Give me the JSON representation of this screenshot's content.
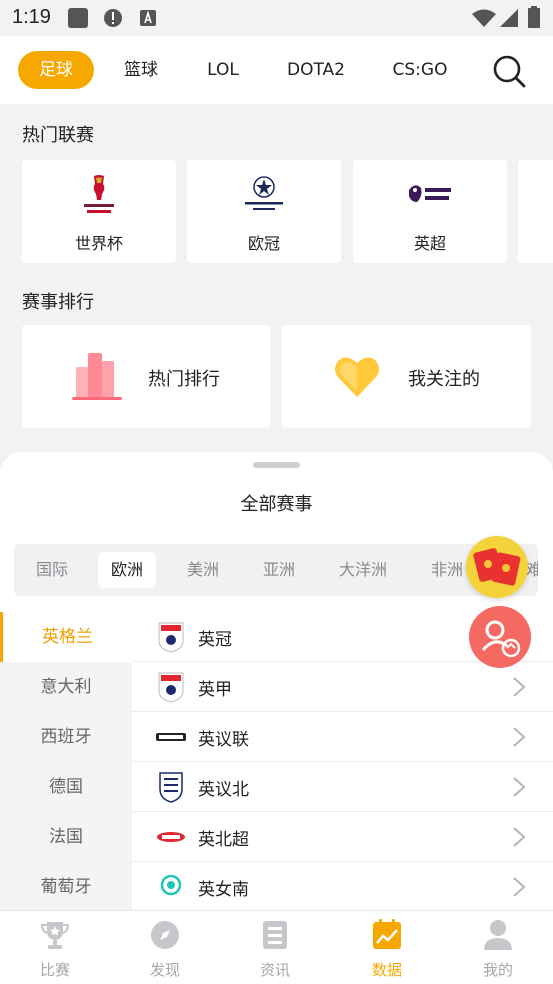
{
  "status_bar": {
    "time": "1:19"
  },
  "top_tabs": [
    {
      "label": "足球",
      "active": true
    },
    {
      "label": "篮球",
      "active": false
    },
    {
      "label": "LOL",
      "active": false
    },
    {
      "label": "DOTA2",
      "active": false
    },
    {
      "label": "CS:GO",
      "active": false
    }
  ],
  "hot_leagues": {
    "title": "热门联赛",
    "items": [
      {
        "name": "世界杯",
        "logo": "fifa-world-cup-logo"
      },
      {
        "name": "欧冠",
        "logo": "champions-league-logo"
      },
      {
        "name": "英超",
        "logo": "premier-league-logo"
      }
    ]
  },
  "rankings": {
    "title": "赛事排行",
    "hot_label": "热门排行",
    "follow_label": "我关注的"
  },
  "sheet": {
    "title": "全部赛事",
    "regions": [
      {
        "label": "国际",
        "active": false
      },
      {
        "label": "欧洲",
        "active": true
      },
      {
        "label": "美洲",
        "active": false
      },
      {
        "label": "亚洲",
        "active": false
      },
      {
        "label": "大洋洲",
        "active": false
      },
      {
        "label": "非洲",
        "active": false
      },
      {
        "label": "难",
        "active": false
      }
    ],
    "countries": [
      {
        "label": "英格兰",
        "active": true
      },
      {
        "label": "意大利",
        "active": false
      },
      {
        "label": "西班牙",
        "active": false
      },
      {
        "label": "德国",
        "active": false
      },
      {
        "label": "法国",
        "active": false
      },
      {
        "label": "葡萄牙",
        "active": false
      }
    ],
    "competitions": [
      {
        "name": "英冠"
      },
      {
        "name": "英甲"
      },
      {
        "name": "英议联"
      },
      {
        "name": "英议北"
      },
      {
        "name": "英北超"
      },
      {
        "name": "英女南"
      }
    ]
  },
  "bottom_nav": [
    {
      "label": "比赛",
      "icon": "trophy-icon",
      "active": false
    },
    {
      "label": "发现",
      "icon": "compass-icon",
      "active": false
    },
    {
      "label": "资讯",
      "icon": "news-icon",
      "active": false
    },
    {
      "label": "数据",
      "icon": "chart-icon",
      "active": true
    },
    {
      "label": "我的",
      "icon": "person-icon",
      "active": false
    }
  ],
  "colors": {
    "accent": "#f7a800",
    "background": "#f2f2f4",
    "fab_red": "#f46a62"
  }
}
